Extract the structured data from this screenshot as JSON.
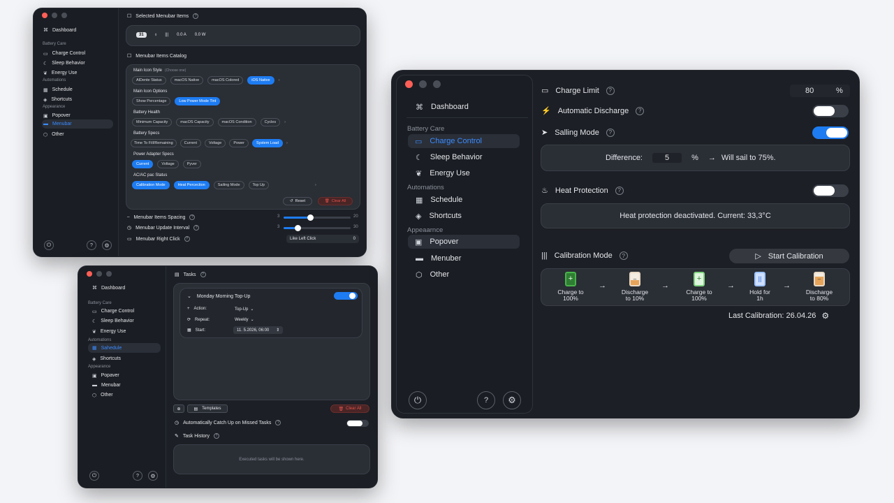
{
  "common": {
    "sidebar": {
      "dashboard": "Dashboard",
      "battery_care": "Battery Care",
      "charge_control": "Charge Control",
      "sleep_behavior": "Sleep Behavior",
      "energy_use": "Energy Use",
      "automations": "Automations",
      "schedule": "Schedule",
      "shortcuts": "Shortcuts",
      "appearance": "Appearance",
      "popover": "Popover",
      "menubar": "Menubar",
      "other": "Other"
    }
  },
  "win1": {
    "sidebar": {
      "dashboard": "Dashboard",
      "battery_care": "Battery Care",
      "charge_control": "Charge Control",
      "sleep_behavior": "Sleep Behavior",
      "energy_use": "Energy Use",
      "automations": "Automations",
      "schedule": "Schedule",
      "shortcuts": "Shortcuts",
      "appearance": "Appearance",
      "popover": "Popover",
      "menubar": "Menubar",
      "other": "Other"
    },
    "selected_title": "Selected Menubar Items",
    "preview": {
      "battery": "31",
      "amps": "0.0 A",
      "watts": "0.0 W"
    },
    "catalog_title": "Menubar Items Catalog",
    "main_icon_style": "Main Icon Style",
    "main_icon_style_hint": "(Choose one)",
    "style_pills": [
      "AlDente Status",
      "macOS Native",
      "macOS Colored",
      "iOS Native"
    ],
    "main_icon_options": "Main Icon Options",
    "option_pills": [
      "Show Percentage",
      "Low Power Mode Tint"
    ],
    "battery_health": "Battery Health",
    "health_pills": [
      "Minimum Capacity",
      "macOS Capacity",
      "macOS Condition",
      "Cycles"
    ],
    "battery_specs": "Battery Specs",
    "spec_pills": [
      "Time To Fill/Remaining",
      "Current",
      "Voltage",
      "Power",
      "System Load"
    ],
    "power_adapter": "Power Adapter Specs",
    "adapter_pills": [
      "Current",
      "Voltage",
      "Pyver"
    ],
    "acdc_status": "AC/AC pac Status",
    "status_pills": [
      "Calibration Mode",
      "Heat Percection",
      "Sailing Mode",
      "Top Up"
    ],
    "reset": "Reset",
    "clear_all": "Clear All",
    "spacing_label": "Menubar Items Spacing",
    "spacing_min": "3",
    "spacing_max": "20",
    "interval_label": "Menubar Update Interval",
    "interval_min": "3",
    "interval_max": "30",
    "right_click_label": "Menubar Right Click",
    "right_click_value": "Like Left Click",
    "right_click_num": "0"
  },
  "win2": {
    "sidebar": {
      "dashboard": "Dashboard",
      "battery_care": "Battery Care",
      "charge_control": "Charge Control",
      "sleep_behavior": "Sleep Behavior",
      "energy_use": "Energy Use",
      "automations": "Automations",
      "schedule": "Sahedule",
      "shortcuts": "Shortcuts",
      "appearance": "Appearance",
      "popover": "Popaver",
      "menubar": "Menubar",
      "other": "Other"
    },
    "tasks_title": "Tasks",
    "task_name": "Monday Morning Top-Up",
    "action_label": "Action:",
    "action_value": "Top-Up",
    "repeat_label": "Repeat:",
    "repeat_value": "Weekly",
    "start_label": "Start:",
    "start_value": "11. 5.2026, 06:00",
    "templates": "Templates",
    "clear_all": "Clear All",
    "catch_up_label": "Automatically Catch Up on Missed Tasks",
    "history_title": "Task History",
    "history_empty": "Executed tasks will be shown here."
  },
  "win3": {
    "sidebar": {
      "dashboard": "Dashboard",
      "battery_care": "Battery Care",
      "charge_control": "Charge Control",
      "sleep_behavior": "Sleep Behavior",
      "energy_use": "Energy Use",
      "automations": "Automations",
      "schedule": "Schedule",
      "shortcuts": "Shortcuts",
      "appearance": "Appeaarnce",
      "popover": "Popover",
      "menubar": "Menuber",
      "other": "Other"
    },
    "charge_limit_label": "Charge Limit",
    "charge_limit_value": "80",
    "charge_limit_unit": "%",
    "auto_discharge_label": "Automatic Discharge",
    "sailing_label": "Salling Mode",
    "difference_label": "Difference:",
    "difference_value": "5",
    "difference_unit": "%",
    "sail_text": "Will sail to 75%.",
    "heat_label": "Heat Protection",
    "heat_status": "Heat protection deactivated.  Current: 33,3°C",
    "calibration_label": "Calibration Mode",
    "start_calibration": "Start Calibration",
    "steps": [
      {
        "l1": "Charge to",
        "l2": "100%"
      },
      {
        "l1": "Discharge",
        "l2": "to 10%"
      },
      {
        "l1": "Charge to",
        "l2": "100%"
      },
      {
        "l1": "Hold for",
        "l2": "1h"
      },
      {
        "l1": "Discharge",
        "l2": "to 80%"
      }
    ],
    "last_calibration": "Last Calibration: 26.04.26"
  },
  "colors": {
    "accent": "#1e7cf2",
    "danger": "#e0524a",
    "window_bg": "#1c1f25"
  },
  "toggles": {
    "auto_discharge": false,
    "sailing_mode": true,
    "heat_protection": false,
    "task_enabled": true,
    "catch_up": false
  }
}
